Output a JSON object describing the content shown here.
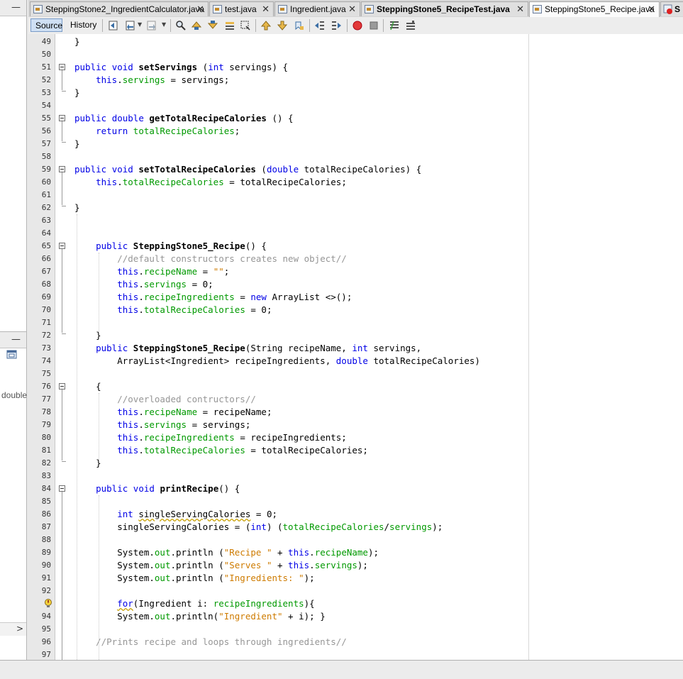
{
  "tabs": [
    {
      "label": "SteppingStone2_IngredientCalculator.java",
      "active": false,
      "bold": false
    },
    {
      "label": "test.java",
      "active": false,
      "bold": false
    },
    {
      "label": "Ingredient.java",
      "active": false,
      "bold": false
    },
    {
      "label": "SteppingStone5_RecipeTest.java",
      "active": false,
      "bold": true
    },
    {
      "label": "SteppingStone5_Recipe.java",
      "active": true,
      "bold": false
    },
    {
      "label": "S",
      "active": false,
      "bold": true
    }
  ],
  "toolbar": {
    "source_label": "Source",
    "history_label": "History"
  },
  "left_panel": {
    "snippet": "double"
  },
  "editor": {
    "lines": [
      {
        "n": "49",
        "html": "}",
        "indent": 0
      },
      {
        "n": "50",
        "html": "",
        "indent": 0
      },
      {
        "n": "51",
        "html": "<span class='kw'>public</span> <span class='kw'>void</span> <span class='b'>setServings</span> (<span class='kw'>int</span> servings) {",
        "indent": 0
      },
      {
        "n": "52",
        "html": "    <span class='kw'>this</span>.<span class='fld'>servings</span> = servings;",
        "indent": 0
      },
      {
        "n": "53",
        "html": "}",
        "indent": 0
      },
      {
        "n": "54",
        "html": "",
        "indent": 0
      },
      {
        "n": "55",
        "html": "<span class='kw'>public</span> <span class='kw'>double</span> <span class='b'>getTotalRecipeCalories</span> () {",
        "indent": 0
      },
      {
        "n": "56",
        "html": "    <span class='kw'>return</span> <span class='fld'>totalRecipeCalories</span>;",
        "indent": 0
      },
      {
        "n": "57",
        "html": "}",
        "indent": 0
      },
      {
        "n": "58",
        "html": "",
        "indent": 0
      },
      {
        "n": "59",
        "html": "<span class='kw'>public</span> <span class='kw'>void</span> <span class='b'>setTotalRecipeCalories</span> (<span class='kw'>double</span> totalRecipeCalories) {",
        "indent": 0
      },
      {
        "n": "60",
        "html": "    <span class='kw'>this</span>.<span class='fld'>totalRecipeCalories</span> = totalRecipeCalories;",
        "indent": 0
      },
      {
        "n": "61",
        "html": "",
        "indent": 0
      },
      {
        "n": "62",
        "html": "}",
        "indent": 0
      },
      {
        "n": "63",
        "html": "",
        "indent": 0
      },
      {
        "n": "64",
        "html": "",
        "indent": 0
      },
      {
        "n": "65",
        "html": "    <span class='kw'>public</span> <span class='b'>SteppingStone5_Recipe</span>() {",
        "indent": 0
      },
      {
        "n": "66",
        "html": "        <span class='cmt'>//default constructors creates new object//</span>",
        "indent": 0
      },
      {
        "n": "67",
        "html": "        <span class='kw'>this</span>.<span class='fld'>recipeName</span> = <span class='str'>\"\"</span>;",
        "indent": 0
      },
      {
        "n": "68",
        "html": "        <span class='kw'>this</span>.<span class='fld'>servings</span> = 0;",
        "indent": 0
      },
      {
        "n": "69",
        "html": "        <span class='kw'>this</span>.<span class='fld'>recipeIngredients</span> = <span class='kw'>new</span> ArrayList &lt;&gt;();",
        "indent": 0
      },
      {
        "n": "70",
        "html": "        <span class='kw'>this</span>.<span class='fld'>totalRecipeCalories</span> = 0;",
        "indent": 0
      },
      {
        "n": "71",
        "html": "",
        "indent": 0
      },
      {
        "n": "72",
        "html": "    }",
        "indent": 0
      },
      {
        "n": "73",
        "html": "    <span class='kw'>public</span> <span class='b'>SteppingStone5_Recipe</span>(String recipeName, <span class='kw'>int</span> servings,",
        "indent": 0
      },
      {
        "n": "74",
        "html": "        ArrayList&lt;Ingredient&gt; recipeIngredients, <span class='kw'>double</span> totalRecipeCalories)",
        "indent": 0
      },
      {
        "n": "75",
        "html": "",
        "indent": 0
      },
      {
        "n": "76",
        "html": "    {",
        "indent": 0
      },
      {
        "n": "77",
        "html": "        <span class='cmt'>//overloaded contructors//</span>",
        "indent": 0
      },
      {
        "n": "78",
        "html": "        <span class='kw'>this</span>.<span class='fld'>recipeName</span> = recipeName;",
        "indent": 0
      },
      {
        "n": "79",
        "html": "        <span class='kw'>this</span>.<span class='fld'>servings</span> = servings;",
        "indent": 0
      },
      {
        "n": "80",
        "html": "        <span class='kw'>this</span>.<span class='fld'>recipeIngredients</span> = recipeIngredients;",
        "indent": 0
      },
      {
        "n": "81",
        "html": "        <span class='kw'>this</span>.<span class='fld'>totalRecipeCalories</span> = totalRecipeCalories;",
        "indent": 0
      },
      {
        "n": "82",
        "html": "    }",
        "indent": 0
      },
      {
        "n": "83",
        "html": "",
        "indent": 0
      },
      {
        "n": "84",
        "html": "    <span class='kw'>public</span> <span class='kw'>void</span> <span class='b'>printRecipe</span>() {",
        "indent": 0
      },
      {
        "n": "85",
        "html": "",
        "indent": 0
      },
      {
        "n": "86",
        "html": "        <span class='kw'>int</span> <span class='warn'>singleServingCalories</span> = 0;",
        "indent": 0
      },
      {
        "n": "87",
        "html": "        singleServingCalories = (<span class='kw'>int</span>) (<span class='fld'>totalRecipeCalories</span>/<span class='fld'>servings</span>);",
        "indent": 0
      },
      {
        "n": "88",
        "html": "",
        "indent": 0
      },
      {
        "n": "89",
        "html": "        System.<span class='fld'>out</span>.println (<span class='str'>\"Recipe \"</span> + <span class='kw'>this</span>.<span class='fld'>recipeName</span>);",
        "indent": 0
      },
      {
        "n": "90",
        "html": "        System.<span class='fld'>out</span>.println (<span class='str'>\"Serves \"</span> + <span class='kw'>this</span>.<span class='fld'>servings</span>);",
        "indent": 0
      },
      {
        "n": "91",
        "html": "        System.<span class='fld'>out</span>.println (<span class='str'>\"Ingredients: \"</span>);",
        "indent": 0
      },
      {
        "n": "92",
        "html": "",
        "indent": 0
      },
      {
        "n": "",
        "html": "        <span class='kw warn'>for</span>(Ingredient i: <span class='fld'>recipeIngredients</span>){",
        "indent": 0
      },
      {
        "n": "94",
        "html": "        System.<span class='fld'>out</span>.println(<span class='str'>\"Ingredient\"</span> + i); }",
        "indent": 0
      },
      {
        "n": "95",
        "html": "",
        "indent": 0
      },
      {
        "n": "96",
        "html": "    <span class='cmt'>//Prints recipe and loops through ingredients//</span>",
        "indent": 0
      },
      {
        "n": "97",
        "html": "",
        "indent": 0
      }
    ]
  },
  "colors": {
    "keyword": "#0000e6",
    "field": "#009900",
    "string": "#ce7b00",
    "comment": "#969696",
    "source_button_bg": "#cfe0f4"
  }
}
